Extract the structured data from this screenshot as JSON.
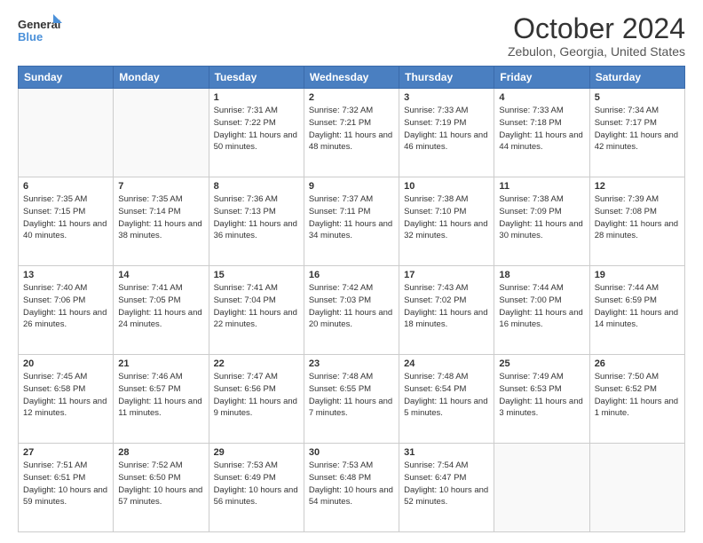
{
  "header": {
    "logo_line1": "General",
    "logo_line2": "Blue",
    "month": "October 2024",
    "location": "Zebulon, Georgia, United States"
  },
  "days_of_week": [
    "Sunday",
    "Monday",
    "Tuesday",
    "Wednesday",
    "Thursday",
    "Friday",
    "Saturday"
  ],
  "weeks": [
    [
      {
        "day": "",
        "info": ""
      },
      {
        "day": "",
        "info": ""
      },
      {
        "day": "1",
        "info": "Sunrise: 7:31 AM\nSunset: 7:22 PM\nDaylight: 11 hours and 50 minutes."
      },
      {
        "day": "2",
        "info": "Sunrise: 7:32 AM\nSunset: 7:21 PM\nDaylight: 11 hours and 48 minutes."
      },
      {
        "day": "3",
        "info": "Sunrise: 7:33 AM\nSunset: 7:19 PM\nDaylight: 11 hours and 46 minutes."
      },
      {
        "day": "4",
        "info": "Sunrise: 7:33 AM\nSunset: 7:18 PM\nDaylight: 11 hours and 44 minutes."
      },
      {
        "day": "5",
        "info": "Sunrise: 7:34 AM\nSunset: 7:17 PM\nDaylight: 11 hours and 42 minutes."
      }
    ],
    [
      {
        "day": "6",
        "info": "Sunrise: 7:35 AM\nSunset: 7:15 PM\nDaylight: 11 hours and 40 minutes."
      },
      {
        "day": "7",
        "info": "Sunrise: 7:35 AM\nSunset: 7:14 PM\nDaylight: 11 hours and 38 minutes."
      },
      {
        "day": "8",
        "info": "Sunrise: 7:36 AM\nSunset: 7:13 PM\nDaylight: 11 hours and 36 minutes."
      },
      {
        "day": "9",
        "info": "Sunrise: 7:37 AM\nSunset: 7:11 PM\nDaylight: 11 hours and 34 minutes."
      },
      {
        "day": "10",
        "info": "Sunrise: 7:38 AM\nSunset: 7:10 PM\nDaylight: 11 hours and 32 minutes."
      },
      {
        "day": "11",
        "info": "Sunrise: 7:38 AM\nSunset: 7:09 PM\nDaylight: 11 hours and 30 minutes."
      },
      {
        "day": "12",
        "info": "Sunrise: 7:39 AM\nSunset: 7:08 PM\nDaylight: 11 hours and 28 minutes."
      }
    ],
    [
      {
        "day": "13",
        "info": "Sunrise: 7:40 AM\nSunset: 7:06 PM\nDaylight: 11 hours and 26 minutes."
      },
      {
        "day": "14",
        "info": "Sunrise: 7:41 AM\nSunset: 7:05 PM\nDaylight: 11 hours and 24 minutes."
      },
      {
        "day": "15",
        "info": "Sunrise: 7:41 AM\nSunset: 7:04 PM\nDaylight: 11 hours and 22 minutes."
      },
      {
        "day": "16",
        "info": "Sunrise: 7:42 AM\nSunset: 7:03 PM\nDaylight: 11 hours and 20 minutes."
      },
      {
        "day": "17",
        "info": "Sunrise: 7:43 AM\nSunset: 7:02 PM\nDaylight: 11 hours and 18 minutes."
      },
      {
        "day": "18",
        "info": "Sunrise: 7:44 AM\nSunset: 7:00 PM\nDaylight: 11 hours and 16 minutes."
      },
      {
        "day": "19",
        "info": "Sunrise: 7:44 AM\nSunset: 6:59 PM\nDaylight: 11 hours and 14 minutes."
      }
    ],
    [
      {
        "day": "20",
        "info": "Sunrise: 7:45 AM\nSunset: 6:58 PM\nDaylight: 11 hours and 12 minutes."
      },
      {
        "day": "21",
        "info": "Sunrise: 7:46 AM\nSunset: 6:57 PM\nDaylight: 11 hours and 11 minutes."
      },
      {
        "day": "22",
        "info": "Sunrise: 7:47 AM\nSunset: 6:56 PM\nDaylight: 11 hours and 9 minutes."
      },
      {
        "day": "23",
        "info": "Sunrise: 7:48 AM\nSunset: 6:55 PM\nDaylight: 11 hours and 7 minutes."
      },
      {
        "day": "24",
        "info": "Sunrise: 7:48 AM\nSunset: 6:54 PM\nDaylight: 11 hours and 5 minutes."
      },
      {
        "day": "25",
        "info": "Sunrise: 7:49 AM\nSunset: 6:53 PM\nDaylight: 11 hours and 3 minutes."
      },
      {
        "day": "26",
        "info": "Sunrise: 7:50 AM\nSunset: 6:52 PM\nDaylight: 11 hours and 1 minute."
      }
    ],
    [
      {
        "day": "27",
        "info": "Sunrise: 7:51 AM\nSunset: 6:51 PM\nDaylight: 10 hours and 59 minutes."
      },
      {
        "day": "28",
        "info": "Sunrise: 7:52 AM\nSunset: 6:50 PM\nDaylight: 10 hours and 57 minutes."
      },
      {
        "day": "29",
        "info": "Sunrise: 7:53 AM\nSunset: 6:49 PM\nDaylight: 10 hours and 56 minutes."
      },
      {
        "day": "30",
        "info": "Sunrise: 7:53 AM\nSunset: 6:48 PM\nDaylight: 10 hours and 54 minutes."
      },
      {
        "day": "31",
        "info": "Sunrise: 7:54 AM\nSunset: 6:47 PM\nDaylight: 10 hours and 52 minutes."
      },
      {
        "day": "",
        "info": ""
      },
      {
        "day": "",
        "info": ""
      }
    ]
  ]
}
